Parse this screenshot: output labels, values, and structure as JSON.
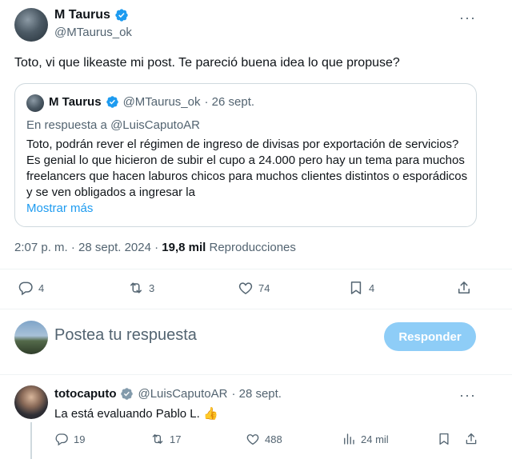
{
  "main_tweet": {
    "author_name": "M Taurus",
    "handle": "@MTaurus_ok",
    "more": "···",
    "text": "Toto, vi que likeaste mi post. Te pareció buena idea lo que propuse?",
    "timestamp": "2:07 p. m. · 28 sept. 2024 · ",
    "views_count": "19,8 mil",
    "views_label": " Reproducciones",
    "stats": {
      "replies": "4",
      "reposts": "3",
      "likes": "74",
      "bookmarks": "4"
    }
  },
  "quoted_tweet": {
    "author_name": "M Taurus",
    "handle": "@MTaurus_ok",
    "date": "· 26 sept.",
    "reply_to": "En respuesta a @LuisCaputoAR",
    "body": "Toto, podrán rever el régimen de ingreso de divisas por exportación de servicios? Es genial lo que hicieron de subir el cupo a 24.000 pero hay un tema para muchos freelancers que hacen laburos chicos para muchos clientes distintos o esporádicos y se ven obligados a ingresar la",
    "show_more": "Mostrar más"
  },
  "composer": {
    "placeholder": "Postea tu respuesta",
    "button_label": "Responder"
  },
  "reply": {
    "author_name": "totocaputo",
    "handle": "@LuisCaputoAR",
    "date": "· 28 sept.",
    "more": "···",
    "text": "La está evaluando Pablo L. 👍",
    "stats": {
      "replies": "19",
      "reposts": "17",
      "likes": "488",
      "views": "24 mil"
    }
  },
  "colors": {
    "accent": "#1d9bf0",
    "muted_text": "#536471",
    "button_disabled": "#8ecdf7",
    "verified_gov": "#829aab"
  }
}
